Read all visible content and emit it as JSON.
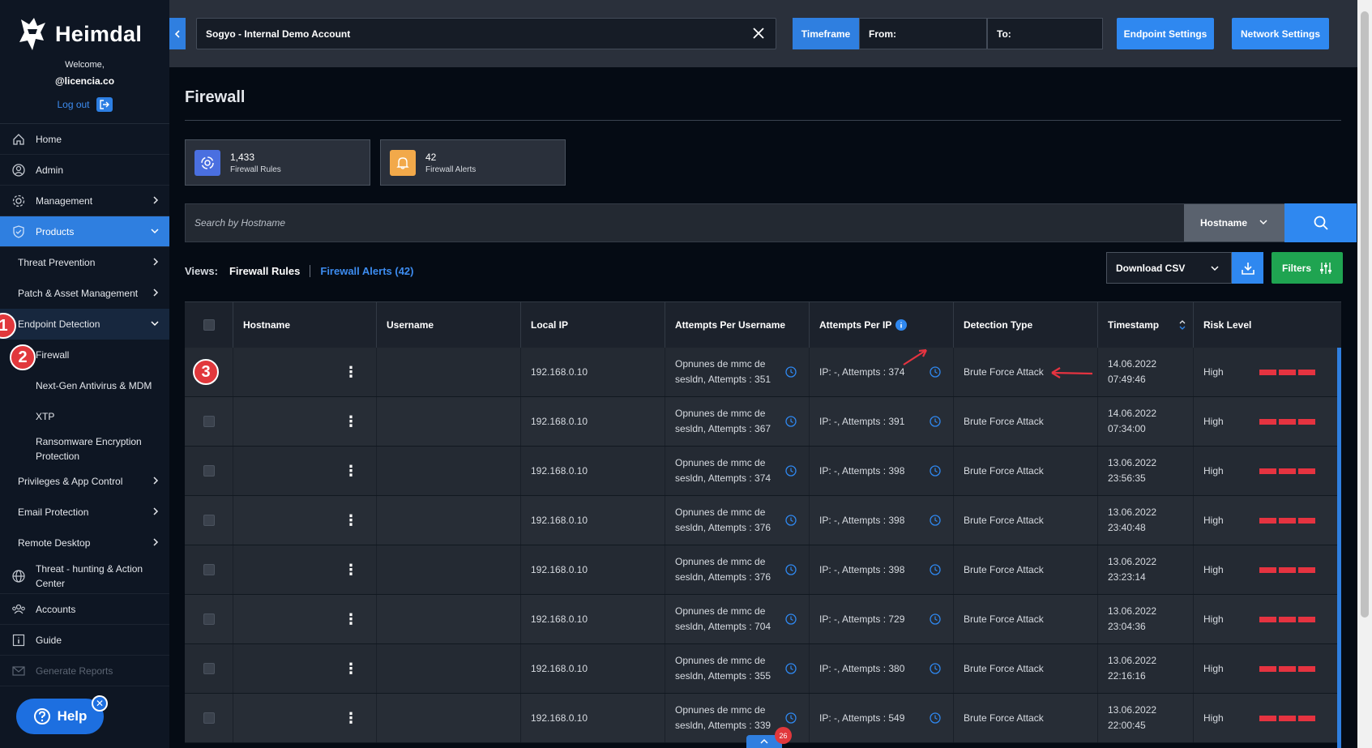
{
  "brand": {
    "name": "Heimdal",
    "welcome": "Welcome,",
    "user": "@licencia.co",
    "logout": "Log out"
  },
  "sidebar": {
    "items": [
      {
        "label": "Home",
        "icon": "home-icon"
      },
      {
        "label": "Admin",
        "icon": "user-circle-icon"
      },
      {
        "label": "Management",
        "icon": "gear-icon"
      },
      {
        "label": "Products",
        "icon": "shield-icon"
      },
      {
        "label": "Threat Prevention"
      },
      {
        "label": "Patch & Asset Management"
      },
      {
        "label": "Endpoint Detection"
      },
      {
        "label": "Firewall"
      },
      {
        "label": "Next-Gen Antivirus & MDM"
      },
      {
        "label": "XTP"
      },
      {
        "label": "Ransomware Encryption Protection"
      },
      {
        "label": "Privileges & App Control"
      },
      {
        "label": "Email Protection"
      },
      {
        "label": "Remote Desktop"
      },
      {
        "label": "Threat - hunting & Action Center",
        "icon": "globe-icon"
      },
      {
        "label": "Accounts",
        "icon": "users-icon"
      },
      {
        "label": "Guide",
        "icon": "info-icon"
      },
      {
        "label": "Generate Reports",
        "icon": "mail-icon"
      }
    ],
    "help": "Help"
  },
  "markers": [
    "1",
    "2",
    "3"
  ],
  "topbar": {
    "account": "Sogyo - Internal Demo Account",
    "timeframe": "Timeframe",
    "from": "From:",
    "to": "To:",
    "endpoint_settings": "Endpoint Settings",
    "network_settings": "Network Settings"
  },
  "page": {
    "title": "Firewall",
    "stats": [
      {
        "value": "1,433",
        "label": "Firewall Rules",
        "color": "#4a6fe0"
      },
      {
        "value": "42",
        "label": "Firewall Alerts",
        "color": "#f2a94a"
      }
    ],
    "search": {
      "placeholder": "Search by Hostname",
      "field": "Hostname"
    },
    "views": {
      "label": "Views:",
      "rules": "Firewall Rules",
      "alerts": "Firewall Alerts (42)"
    },
    "download_csv": "Download CSV",
    "filters": "Filters"
  },
  "table": {
    "columns": [
      "Hostname",
      "Username",
      "Local IP",
      "Attempts Per Username",
      "Attempts Per IP",
      "Detection Type",
      "Timestamp",
      "Risk Level"
    ],
    "rows": [
      {
        "ip": "192.168.0.10",
        "apu1": "Opnunes de mmc de",
        "apu2": "sesldn, Attempts : 351",
        "api": "IP: -, Attempts : 374",
        "type": "Brute Force Attack",
        "date": "14.06.2022",
        "time": "07:49:46",
        "risk": "High"
      },
      {
        "ip": "192.168.0.10",
        "apu1": "Opnunes de mmc de",
        "apu2": "sesldn, Attempts : 367",
        "api": "IP: -, Attempts : 391",
        "type": "Brute Force Attack",
        "date": "14.06.2022",
        "time": "07:34:00",
        "risk": "High"
      },
      {
        "ip": "192.168.0.10",
        "apu1": "Opnunes de mmc de",
        "apu2": "sesldn, Attempts : 374",
        "api": "IP: -, Attempts : 398",
        "type": "Brute Force Attack",
        "date": "13.06.2022",
        "time": "23:56:35",
        "risk": "High"
      },
      {
        "ip": "192.168.0.10",
        "apu1": "Opnunes de mmc de",
        "apu2": "sesldn, Attempts : 376",
        "api": "IP: -, Attempts : 398",
        "type": "Brute Force Attack",
        "date": "13.06.2022",
        "time": "23:40:48",
        "risk": "High"
      },
      {
        "ip": "192.168.0.10",
        "apu1": "Opnunes de mmc de",
        "apu2": "sesldn, Attempts : 376",
        "api": "IP: -, Attempts : 398",
        "type": "Brute Force Attack",
        "date": "13.06.2022",
        "time": "23:23:14",
        "risk": "High"
      },
      {
        "ip": "192.168.0.10",
        "apu1": "Opnunes de mmc de",
        "apu2": "sesldn, Attempts : 704",
        "api": "IP: -, Attempts : 729",
        "type": "Brute Force Attack",
        "date": "13.06.2022",
        "time": "23:04:36",
        "risk": "High"
      },
      {
        "ip": "192.168.0.10",
        "apu1": "Opnunes de mmc de",
        "apu2": "sesldn, Attempts : 355",
        "api": "IP: -, Attempts : 380",
        "type": "Brute Force Attack",
        "date": "13.06.2022",
        "time": "22:16:16",
        "risk": "High"
      },
      {
        "ip": "192.168.0.10",
        "apu1": "Opnunes de mmc de",
        "apu2": "sesldn, Attempts : 339",
        "api": "IP: -, Attempts : 549",
        "type": "Brute Force Attack",
        "date": "13.06.2022",
        "time": "22:00:45",
        "risk": "High"
      }
    ]
  },
  "notification_count": "26",
  "colors": {
    "accent": "#2f7fe0",
    "success": "#1fa451",
    "danger": "#e53340"
  }
}
